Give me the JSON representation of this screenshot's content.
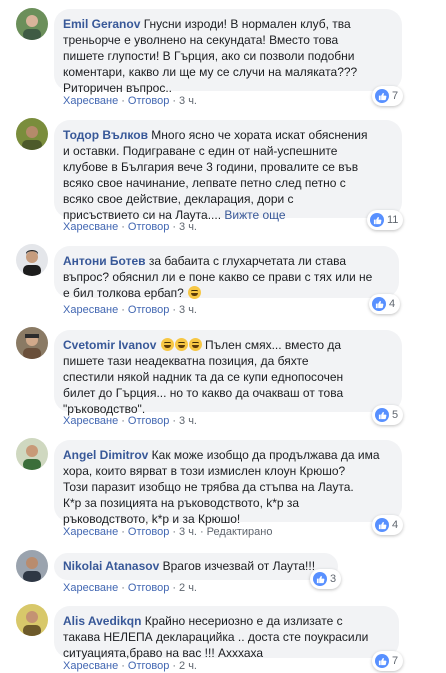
{
  "ui": {
    "like_label": "Харесване",
    "reply_label": "Отговор",
    "see_more_label": "Вижте още"
  },
  "comments": [
    {
      "author": "Emil Geranov",
      "text": " Гнусни изроди! В нормален клуб, тва\nтреньорче е уволнено на секундата! Вместо това\nпишете глупости! В Гърция, ако си позволи подобни\nкоментари, какво ли ще му се случи на малякaта???\nРиторичен въпрос..",
      "time": "3 ч.",
      "reactions": "7",
      "edited": ""
    },
    {
      "author": "Тодор Вълков",
      "text": " Много ясно че хората искат обяснения\nи оставки. Подиграване с един от най-успешните\nклубове в България вече 3 години, провалите се във\nвсяко свое начинание, лепвате петно след петно с\nвсяко свое действие, декларация, дори с\nприсъствието си на Лаута.... ",
      "time": "3 ч.",
      "reactions": "11",
      "edited": ""
    },
    {
      "author": "Антони Ботев",
      "text": " за бабаита с глухарчетата ли става\nвъпрос? обяснил ли е поне какво се прави с тях или не\nе бил толкова ербап? ",
      "time": "3 ч.",
      "reactions": "4",
      "edited": ""
    },
    {
      "author": "Cvetomir Ivanov",
      "text": " Пълен смях... вместо да\nпишете тази неадекватна позиция, да бяхте\nспестили някой надник та да се купи еднопосочен\nбилет до Гърция... но то какво да очакваш от това\n\"ръководство\".",
      "time": "3 ч.",
      "reactions": "5",
      "edited": ""
    },
    {
      "author": "Angel Dimitrov",
      "text": " Как може изобщо да продължава да има\nхора, които вярват в този измислен клоун Крюшо?\nТози паразит изобщо не трябва да стъпва на Лаута.\nК*р за позицията на ръководството, k*p за\nръководството, k*p и за Крюшо!",
      "time": "3 ч.",
      "reactions": "4",
      "edited": "Редактирано"
    },
    {
      "author": "Nikolai Atanasov",
      "text": " Врагов изчезвай от Лаута!!!",
      "time": "2 ч.",
      "reactions": "3",
      "edited": ""
    },
    {
      "author": "Alis Avedikqn",
      "text": " Крайно несериозно е да излизате с\nтакава НЕЛЕПА декларацийка .. доста сте поукрасили\nситуацията,браво на вас !!! Ахххаха",
      "time": "2 ч.",
      "reactions": "7",
      "edited": ""
    }
  ],
  "colors": {
    "author": "#385898",
    "bubble": "#f2f3f5",
    "like": "#5890ff",
    "meta": "#606770"
  },
  "icons": [
    "like-icon",
    "laughing-emoji-icon"
  ]
}
